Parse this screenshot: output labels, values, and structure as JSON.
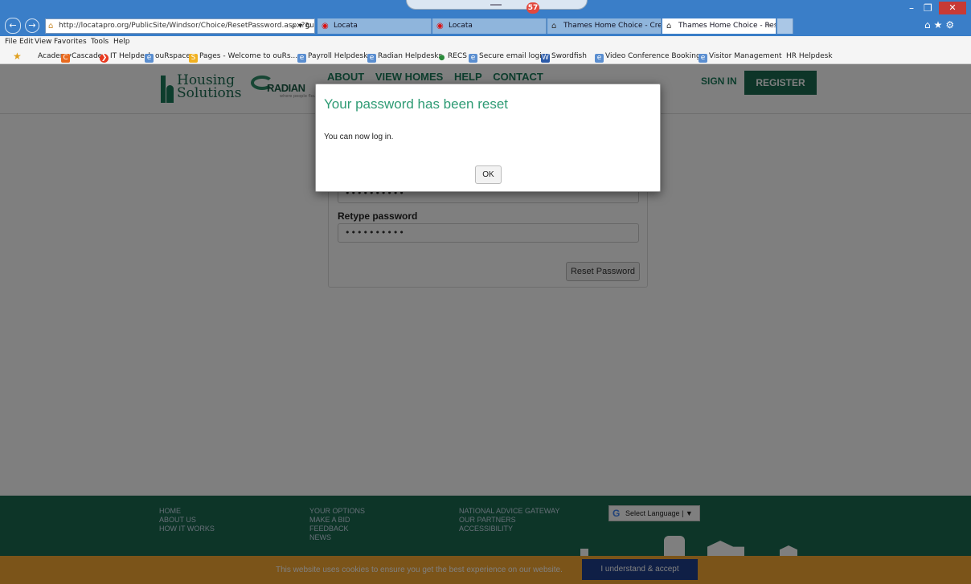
{
  "browser": {
    "notification_count": "57",
    "address": "http://locatapro.org/PublicSite/Windsor/Choice/ResetPassword.aspx?gui",
    "tabs": [
      {
        "label": "Locata"
      },
      {
        "label": "Locata"
      },
      {
        "label": "Thames Home Choice - Create..."
      },
      {
        "label": "Thames Home Choice - Res..."
      }
    ],
    "menu": [
      "File",
      "Edit",
      "View",
      "Favorites",
      "Tools",
      "Help"
    ],
    "favorites": [
      "Academy",
      "Cascade",
      "IT Helpdesk",
      "ouRspace",
      "Pages - Welcome to ouRs...",
      "Payroll Helpdesk",
      "Radian Helpdesks",
      "RECS",
      "Secure email login",
      "Swordfish",
      "Video Conference Bookings",
      "Visitor Management",
      "HR Helpdesk"
    ]
  },
  "site": {
    "logo_line1": "Housing",
    "logo_line2": "Solutions",
    "partner_logo": "RADIAN",
    "partner_tagline": "where people flourish",
    "nav": [
      "ABOUT",
      "VIEW HOMES",
      "HELP",
      "CONTACT"
    ],
    "sign_in": "SIGN IN",
    "register": "REGISTER"
  },
  "form": {
    "password_value": "••••••••••",
    "retype_label": "Retype password",
    "retype_value": "••••••••••",
    "reset_button": "Reset Password"
  },
  "footer": {
    "col1": [
      "HOME",
      "ABOUT US",
      "HOW IT WORKS"
    ],
    "col2": [
      "YOUR OPTIONS",
      "MAKE A BID",
      "FEEDBACK",
      "NEWS"
    ],
    "col3": [
      "NATIONAL ADVICE GATEWAY",
      "OUR PARTNERS",
      "ACCESSIBILITY"
    ],
    "language": "Select Language"
  },
  "cookie": {
    "text": "This website uses cookies to ensure you get the best experience on our website.",
    "accept": "I understand & accept"
  },
  "modal": {
    "title": "Your password has been reset",
    "body": "You can now log in.",
    "ok": "OK"
  },
  "colors": {
    "brand_green": "#1a6a50",
    "modal_title": "#2e9b74",
    "cookie_bar": "#f7a833",
    "cookie_button": "#1f3e8c"
  }
}
